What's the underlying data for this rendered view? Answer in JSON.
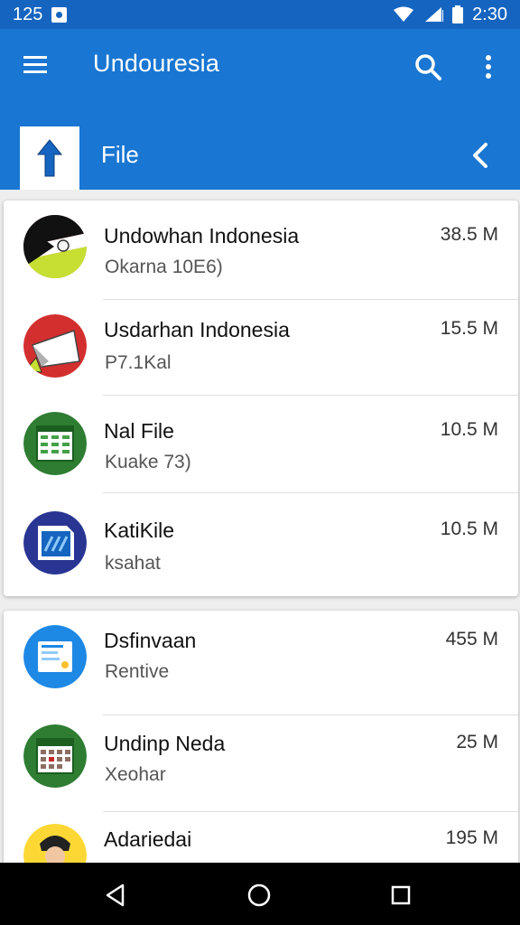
{
  "status_bar": {
    "left_text": "125",
    "time": "2:30",
    "icons": [
      "notification-icon",
      "wifi-icon",
      "signal-icon",
      "battery-icon"
    ]
  },
  "app_bar": {
    "title": "Undouresia",
    "path_label": "File",
    "icons": [
      "menu-icon",
      "search-icon",
      "more-vert-icon",
      "upload-folder-icon",
      "chevron-left-icon"
    ]
  },
  "files_group_1": [
    {
      "name": "Undowhan Indonesia",
      "sub": "Okarna 10E6)",
      "size": "38.5 M"
    },
    {
      "name": "Usdarhan Indonesia",
      "sub": "P7.1Kal",
      "size": "15.5 M"
    },
    {
      "name": "Nal File",
      "sub": "Kuake 73)",
      "size": "10.5 M"
    },
    {
      "name": "KatiKile",
      "sub": "ksahat",
      "size": "10.5 M"
    }
  ],
  "files_group_2": [
    {
      "name": "Dsfinvaan",
      "sub": "Rentive",
      "size": "455 M"
    },
    {
      "name": "Undinp Neda",
      "sub": "Xeohar",
      "size": "25 M"
    },
    {
      "name": "Adariedai",
      "sub": "",
      "size": "195 M"
    }
  ],
  "nav_bar": {
    "icons": [
      "back-nav-icon",
      "home-nav-icon",
      "recents-nav-icon"
    ]
  }
}
